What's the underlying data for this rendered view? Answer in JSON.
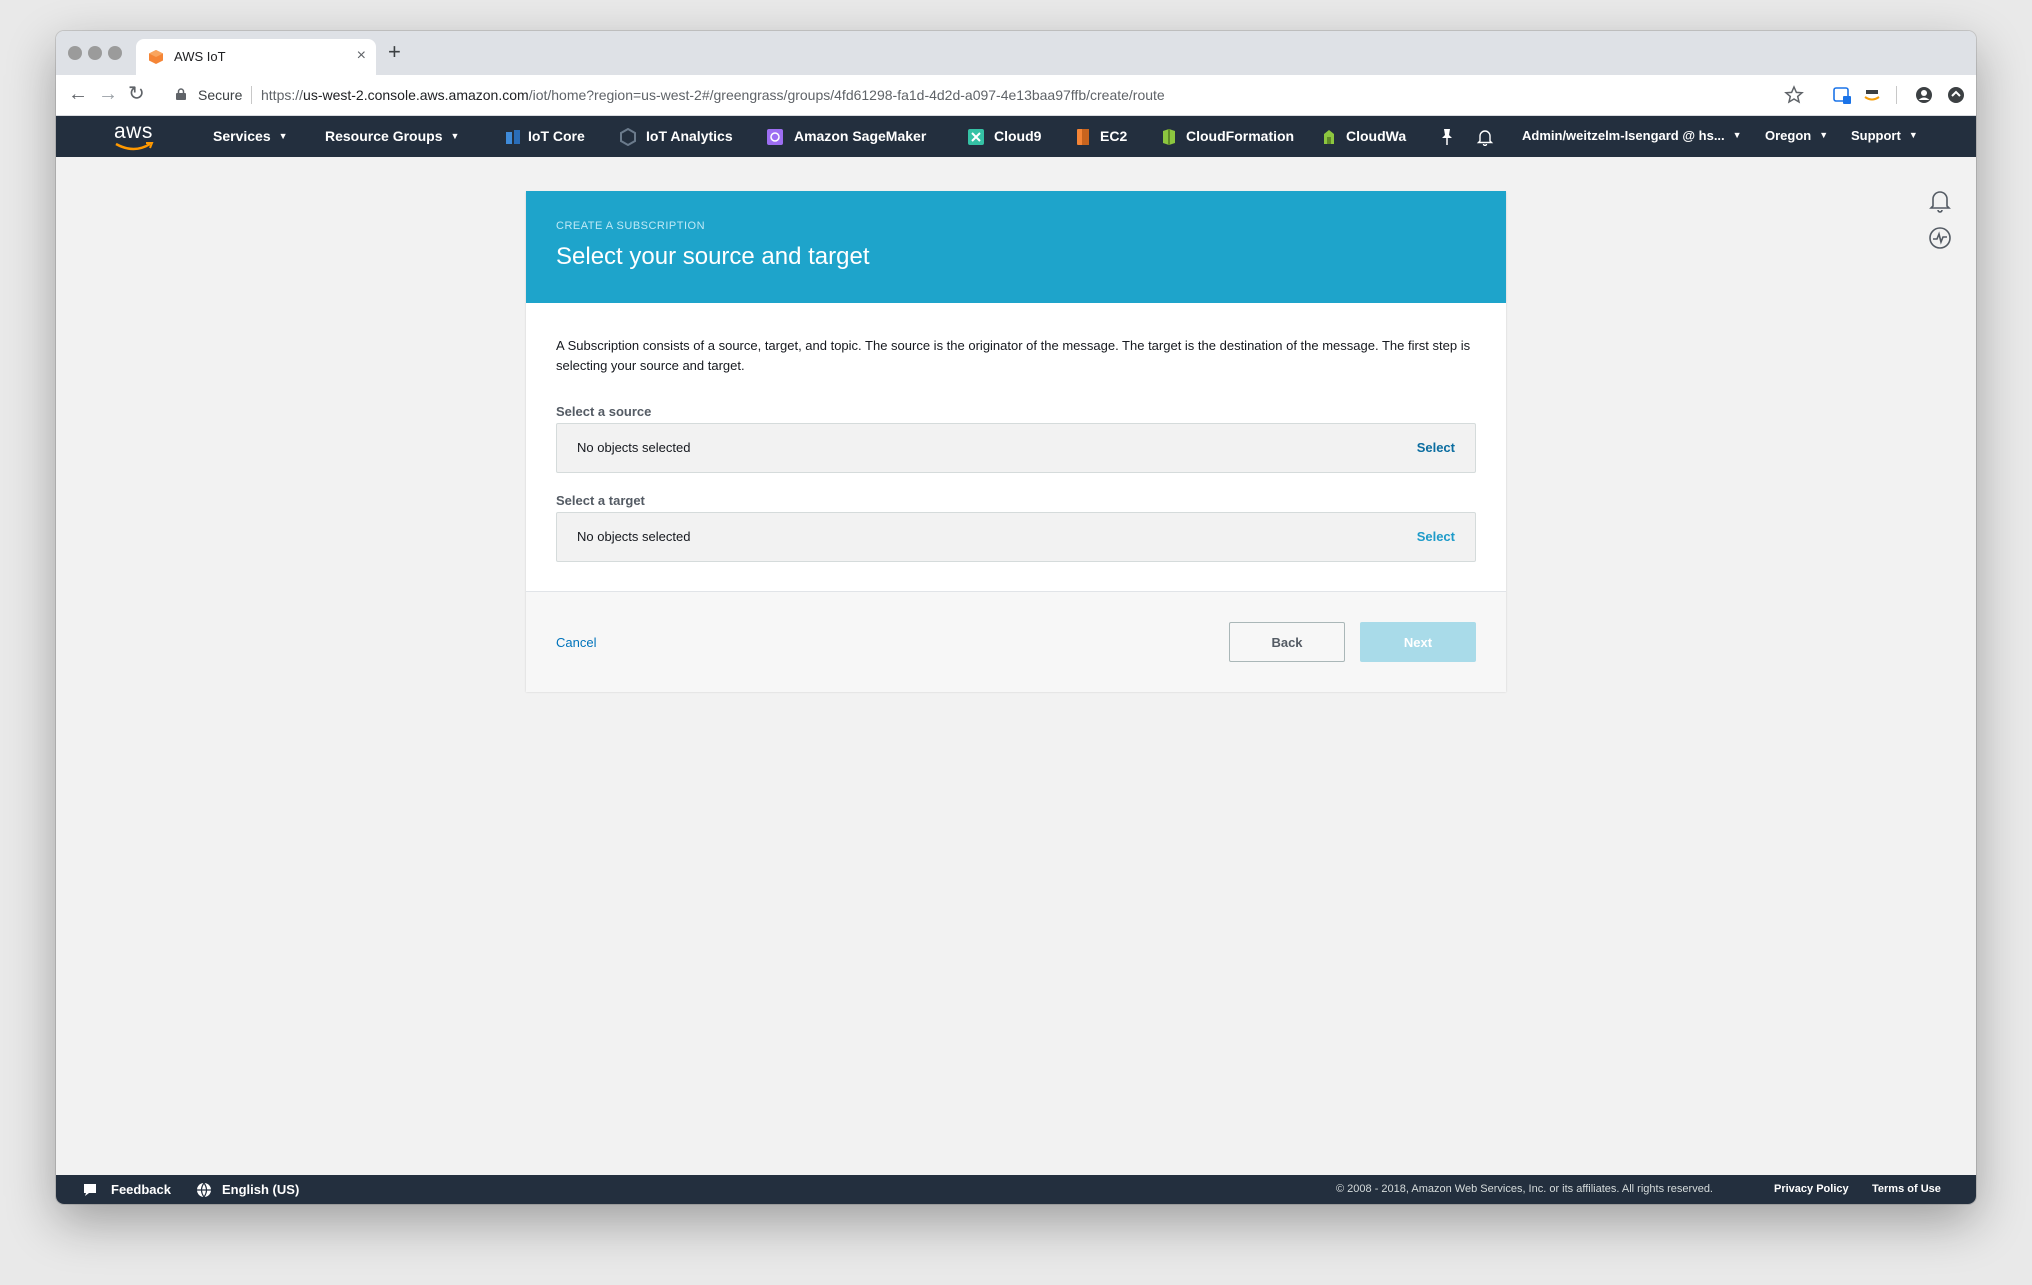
{
  "browser": {
    "tab_title": "AWS IoT",
    "new_tab": "+",
    "close_tab": "×",
    "secure_label": "Secure",
    "url_prefix": "https://",
    "url_host": "us-west-2.console.aws.amazon.com",
    "url_path": "/iot/home?region=us-west-2#/greengrass/groups/4fd61298-fa1d-4d2d-a097-4e13baa97ffb/create/route"
  },
  "awsnav": {
    "logo_text": "aws",
    "services": "Services",
    "resource_groups": "Resource Groups",
    "shortcuts": [
      {
        "label": "IoT Core",
        "color": "#3f8bd9"
      },
      {
        "label": "IoT Analytics",
        "color": "#6b7b8c"
      },
      {
        "label": "Amazon SageMaker",
        "color": "#9d6ef2"
      },
      {
        "label": "Cloud9",
        "color": "#35c2a5"
      },
      {
        "label": "EC2",
        "color": "#f58536"
      },
      {
        "label": "CloudFormation",
        "color": "#8cc63f"
      },
      {
        "label": "CloudWa",
        "color": "#8cc63f"
      }
    ],
    "account": "Admin/weitzelm-Isengard @ hs...",
    "region": "Oregon",
    "support": "Support"
  },
  "card": {
    "eyebrow": "CREATE A SUBSCRIPTION",
    "title": "Select your source and target",
    "description": "A Subscription consists of a source, target, and topic. The source is the originator of the message. The target is the destination of the message. The first step is selecting your source and target.",
    "source_label": "Select a source",
    "source_value": "No objects selected",
    "source_select": "Select",
    "target_label": "Select a target",
    "target_value": "No objects selected",
    "target_select": "Select",
    "cancel": "Cancel",
    "back": "Back",
    "next": "Next"
  },
  "colors": {
    "header_blue": "#1ea4cb",
    "nav_bg": "#232f3e",
    "link_blue": "#0073bb",
    "next_disabled": "#a9dbe9",
    "source_select_color": "#0b6da0",
    "target_select_color": "#1e9bc9"
  },
  "footer": {
    "feedback": "Feedback",
    "language": "English (US)",
    "copyright": "© 2008 - 2018, Amazon Web Services, Inc. or its affiliates. All rights reserved.",
    "privacy": "Privacy Policy",
    "terms": "Terms of Use"
  }
}
